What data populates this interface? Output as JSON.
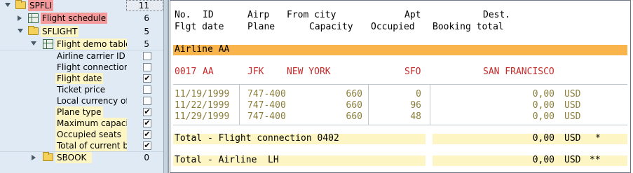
{
  "tree": {
    "nodes": [
      {
        "label": "SPFLI",
        "count": "11"
      },
      {
        "label": "Flight schedule",
        "count": "6"
      },
      {
        "label": "SFLIGHT",
        "count": "5"
      },
      {
        "label": "Flight demo table",
        "count": "5"
      },
      {
        "label": "Airline carrier ID",
        "checked": false
      },
      {
        "label": "Flight connection",
        "checked": false
      },
      {
        "label": "Flight date",
        "checked": true
      },
      {
        "label": "Ticket price",
        "checked": false
      },
      {
        "label": "Local currency of",
        "checked": false
      },
      {
        "label": "Plane type",
        "checked": true
      },
      {
        "label": "Maximum capaci",
        "checked": true
      },
      {
        "label": "Occupied seats",
        "checked": true
      },
      {
        "label": "Total of current b",
        "checked": true
      },
      {
        "label": "SBOOK",
        "count": "0"
      }
    ],
    "check_glyph": "✔"
  },
  "list": {
    "header1": {
      "no": "No.",
      "id": "ID",
      "airp": "Airp",
      "from": "From city",
      "apt": "Apt",
      "dest": "Dest."
    },
    "header2": {
      "date": "Flgt date",
      "plane": "Plane",
      "capacity": "Capacity",
      "occupied": "Occupied",
      "booking": "Booking total"
    },
    "airline_group": "Airline AA",
    "connection": {
      "no": "0017",
      "carrier": "AA",
      "airport_from": "JFK",
      "city_from": "NEW YORK",
      "airport_to": "SFO",
      "city_to": "SAN FRANCISCO"
    },
    "flights": [
      {
        "date": "11/19/1999",
        "plane": "747-400",
        "capacity": "660",
        "occupied": "0",
        "total": "0,00",
        "currency": "USD"
      },
      {
        "date": "11/22/1999",
        "plane": "747-400",
        "capacity": "660",
        "occupied": "96",
        "total": "0,00",
        "currency": "USD"
      },
      {
        "date": "11/29/1999",
        "plane": "747-400",
        "capacity": "660",
        "occupied": "48",
        "total": "0,00",
        "currency": "USD"
      }
    ],
    "subtotal1": {
      "label": "Total - Flight connection 0402",
      "value": "0,00",
      "currency": "USD",
      "mark": "*"
    },
    "subtotal2": {
      "label": "Total - Airline  LH",
      "value": "0,00",
      "currency": "USD",
      "mark": "**"
    }
  },
  "colors": {
    "tree_bg": "#dfeaf4",
    "highlight_pink": "#f59a9a",
    "highlight_yellow": "#fdf6c4",
    "group_band": "#f9b54c",
    "connection_text": "#c62a2a",
    "data_text": "#8a7e3a"
  }
}
